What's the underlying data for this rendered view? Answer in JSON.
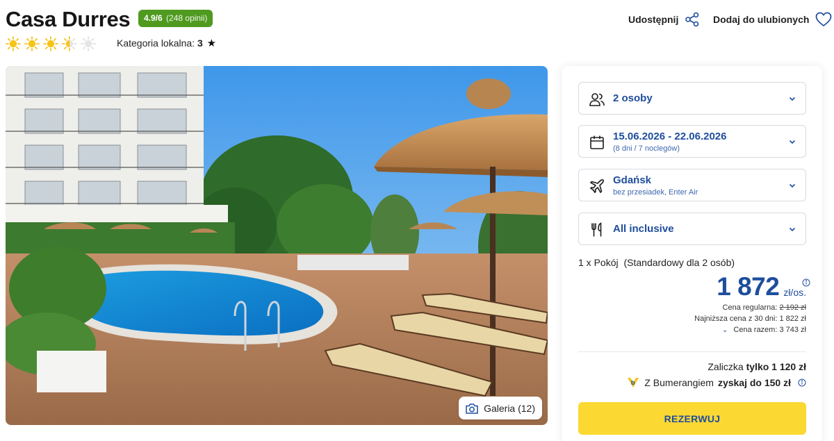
{
  "hotel": {
    "name": "Casa Durres",
    "rating_score": "4.9/6",
    "rating_count": "(248 opinii)",
    "stars_full": 3,
    "stars_half": 1,
    "stars_total": 5,
    "local_category_label": "Kategoria lokalna:",
    "local_category_value": "3"
  },
  "actions": {
    "share_label": "Udostępnij",
    "favorite_label": "Dodaj do ulubionych"
  },
  "gallery": {
    "label": "Galeria (12)"
  },
  "booking": {
    "guests": "2 osoby",
    "dates": "15.06.2026 - 22.06.2026",
    "dates_sub": "(8 dni / 7 noclegów)",
    "departure": "Gdańsk",
    "departure_sub": "bez przesiadek, Enter Air",
    "board": "All inclusive",
    "room_count": "1 x Pokój",
    "room_type": "(Standardowy dla 2 osób)",
    "price": "1 872",
    "price_unit": "zł/os.",
    "regular_label": "Cena regularna:",
    "regular_value": "2 192 zł",
    "lowest_label": "Najniższa cena z 30 dni:",
    "lowest_value": "1 822 zł",
    "total_label": "Cena razem:",
    "total_value": "3 743 zł",
    "deposit_label": "Zaliczka",
    "deposit_value": "tylko 1 120 zł",
    "boomerang_label": "Z Bumerangiem",
    "boomerang_value": "zyskaj do 150 zł",
    "reserve_label": "REZERWUJ"
  },
  "colors": {
    "accent_blue": "#1e4d9c",
    "rating_green": "#4f9a1f",
    "reserve_yellow": "#fcd833",
    "sun_yellow": "#f6c318"
  }
}
